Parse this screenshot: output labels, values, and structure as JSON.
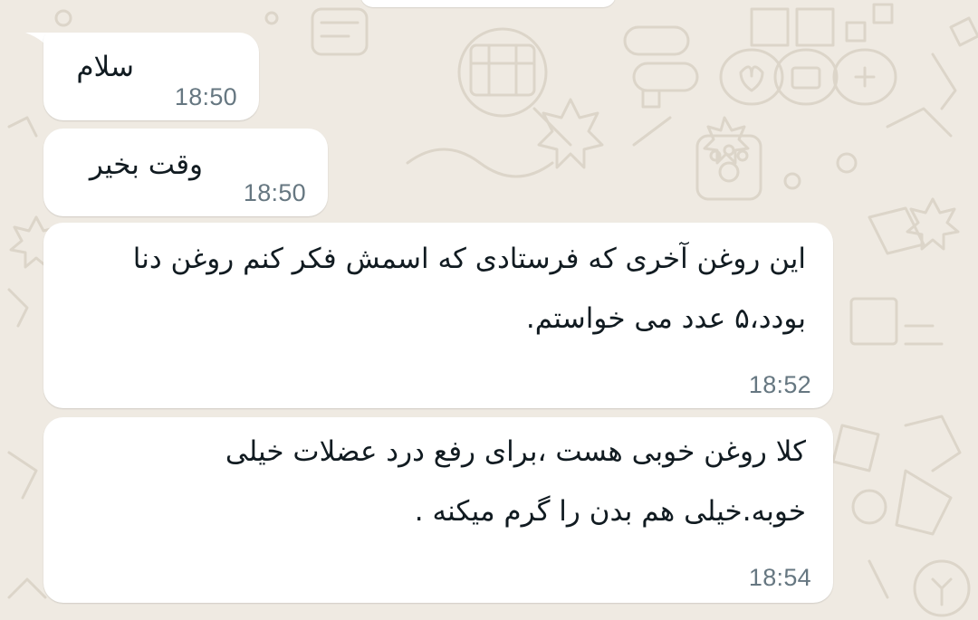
{
  "theme": {
    "wallpaper_color": "#efeae2",
    "bubble_color": "#ffffff",
    "text_color": "#111b21",
    "time_color": "#667781"
  },
  "messages": [
    {
      "lines": [
        "سلام"
      ],
      "time": "18:50"
    },
    {
      "lines": [
        "وقت بخیر"
      ],
      "time": "18:50"
    },
    {
      "lines": [
        "این روغن آخری که فرستادی که اسمش فکر کنم روغن دنا",
        "بودد،۵  عدد می خواستم."
      ],
      "time": "18:52"
    },
    {
      "lines": [
        "کلا روغن خوبی هست ،برای رفع درد عضلات خیلی",
        "خوبه.خیلی هم بدن را گرم میکنه ."
      ],
      "time": "18:54"
    }
  ]
}
